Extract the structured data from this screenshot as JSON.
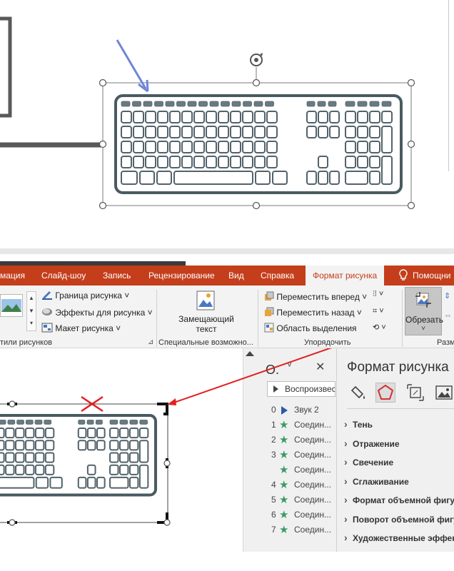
{
  "ribbon": {
    "tabs": [
      {
        "label": "мация",
        "active": false
      },
      {
        "label": "Слайд-шоу",
        "active": false
      },
      {
        "label": "Запись",
        "active": false
      },
      {
        "label": "Рецензирование",
        "active": false
      },
      {
        "label": "Вид",
        "active": false
      },
      {
        "label": "Справка",
        "active": false
      },
      {
        "label": "Формат рисунка",
        "active": true
      },
      {
        "label": "Помощни",
        "active": false
      }
    ],
    "picture_border": "Граница рисунка",
    "picture_effects": "Эффекты для рисунка",
    "picture_layout": "Макет рисунка",
    "group_styles": "тили рисунков",
    "alt_text_line1": "Замещающий",
    "alt_text_line2": "текст",
    "group_accessibility": "Специальные возможно...",
    "bring_forward": "Переместить вперед",
    "send_backward": "Переместить назад",
    "selection_pane": "Область выделения",
    "group_arrange": "Упорядочить",
    "crop": "Обрезать",
    "group_size": "Разм"
  },
  "animation_pane": {
    "title": "О.",
    "play_label": "Воспроизвест",
    "items": [
      {
        "num": "0",
        "kind": "sound",
        "label": "Звук 2"
      },
      {
        "num": "1",
        "kind": "star",
        "label": "Соедин..."
      },
      {
        "num": "2",
        "kind": "star",
        "label": "Соедин..."
      },
      {
        "num": "3",
        "kind": "star",
        "label": "Соедин..."
      },
      {
        "num": "",
        "kind": "star",
        "label": "Соедин..."
      },
      {
        "num": "4",
        "kind": "star",
        "label": "Соедин..."
      },
      {
        "num": "5",
        "kind": "star",
        "label": "Соедин..."
      },
      {
        "num": "6",
        "kind": "star",
        "label": "Соедин..."
      },
      {
        "num": "7",
        "kind": "star",
        "label": "Соедин..."
      }
    ]
  },
  "format_pane": {
    "title": "Формат рисунка",
    "sections": [
      "Тень",
      "Отражение",
      "Свечение",
      "Сглаживание",
      "Формат объемной фигуры",
      "Поворот объемной фигуры",
      "Художественные эффекты"
    ]
  },
  "colors": {
    "accent": "#c43e1c",
    "annotation_red": "#e32020",
    "annotation_blue": "#6f86d6"
  }
}
